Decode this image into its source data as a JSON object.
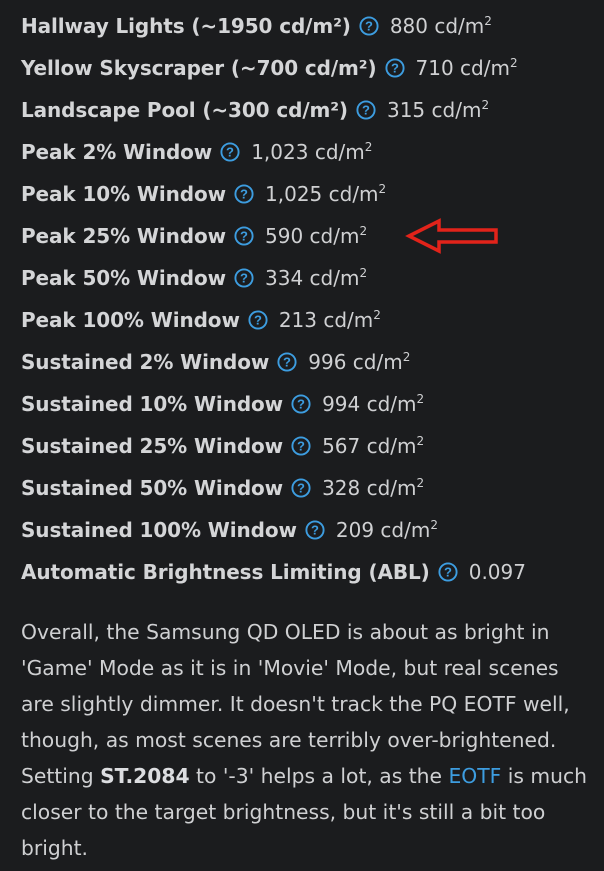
{
  "measurements": [
    {
      "label": "Hallway Lights (~1950 cd/m²)",
      "value": "880 cd/m",
      "unit_sup": "2"
    },
    {
      "label": "Yellow Skyscraper (~700 cd/m²)",
      "value": "710 cd/m",
      "unit_sup": "2"
    },
    {
      "label": "Landscape Pool (~300 cd/m²)",
      "value": "315 cd/m",
      "unit_sup": "2"
    },
    {
      "label": "Peak 2% Window",
      "value": "1,023 cd/m",
      "unit_sup": "2"
    },
    {
      "label": "Peak 10% Window",
      "value": "1,025 cd/m",
      "unit_sup": "2"
    },
    {
      "label": "Peak 25% Window",
      "value": "590 cd/m",
      "unit_sup": "2"
    },
    {
      "label": "Peak 50% Window",
      "value": "334 cd/m",
      "unit_sup": "2"
    },
    {
      "label": "Peak 100% Window",
      "value": "213 cd/m",
      "unit_sup": "2"
    },
    {
      "label": "Sustained 2% Window",
      "value": "996 cd/m",
      "unit_sup": "2"
    },
    {
      "label": "Sustained 10% Window",
      "value": "994 cd/m",
      "unit_sup": "2"
    },
    {
      "label": "Sustained 25% Window",
      "value": "567 cd/m",
      "unit_sup": "2"
    },
    {
      "label": "Sustained 50% Window",
      "value": "328 cd/m",
      "unit_sup": "2"
    },
    {
      "label": "Sustained 100% Window",
      "value": "209 cd/m",
      "unit_sup": "2"
    },
    {
      "label": "Automatic Brightness Limiting (ABL)",
      "value": "0.097",
      "unit_sup": ""
    }
  ],
  "icons": {
    "info": "question-circle-icon",
    "annotation": "red-arrow-icon"
  },
  "colors": {
    "background": "#1b1c1e",
    "text": "#cfd0d2",
    "link": "#3d9de0",
    "icon": "#3d9de0",
    "arrow": "#e2231a"
  },
  "summary": {
    "part1": "Overall, the Samsung QD OLED is about as bright in 'Game' Mode as it is in 'Movie' Mode, but real scenes are slightly dimmer. It doesn't track the PQ EOTF well, though, as most scenes are terribly over-brightened. Setting ",
    "bold": "ST.2084",
    "part2": " to '-3' helps a lot, as the ",
    "link": "EOTF",
    "part3": " is much closer to the target brightness, but it's still a bit too bright."
  }
}
